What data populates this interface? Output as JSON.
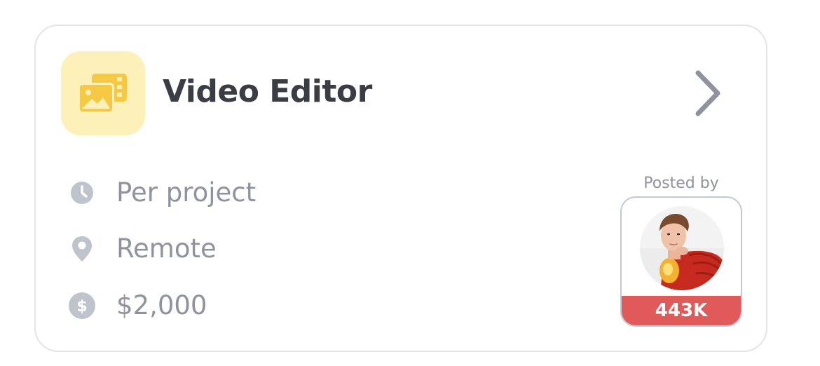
{
  "job": {
    "title": "Video Editor",
    "icon": "image-gallery-icon",
    "details": [
      {
        "icon": "clock-icon",
        "text": "Per project"
      },
      {
        "icon": "location-pin-icon",
        "text": "Remote"
      },
      {
        "icon": "dollar-icon",
        "text": "$2,000"
      }
    ]
  },
  "poster": {
    "label": "Posted by",
    "count": "443K"
  },
  "colors": {
    "icon_bg": "#fdf0b8",
    "icon_fg": "#f6c945",
    "title": "#3b3d45",
    "detail_text": "#8e939e",
    "detail_icon": "#bfc3cc",
    "badge": "#e05a5a",
    "border": "#e2e4ea"
  }
}
